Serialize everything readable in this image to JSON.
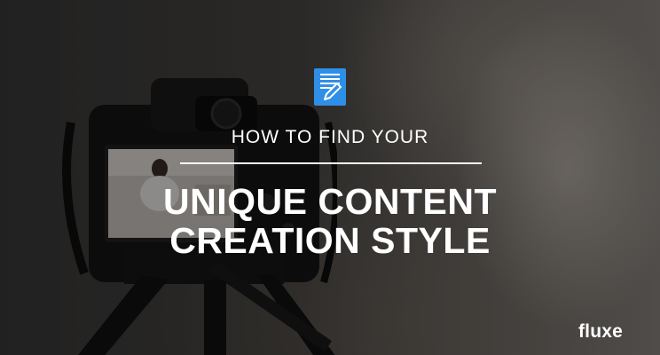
{
  "graphic": {
    "subtitle": "HOW TO FIND YOUR",
    "title_line_1": "UNIQUE CONTENT",
    "title_line_2": "CREATION STYLE",
    "brand": "fluxe"
  },
  "icons": {
    "header_icon": "document-edit-icon"
  },
  "colors": {
    "icon_blue": "#2f8fe6",
    "text": "#ffffff"
  }
}
